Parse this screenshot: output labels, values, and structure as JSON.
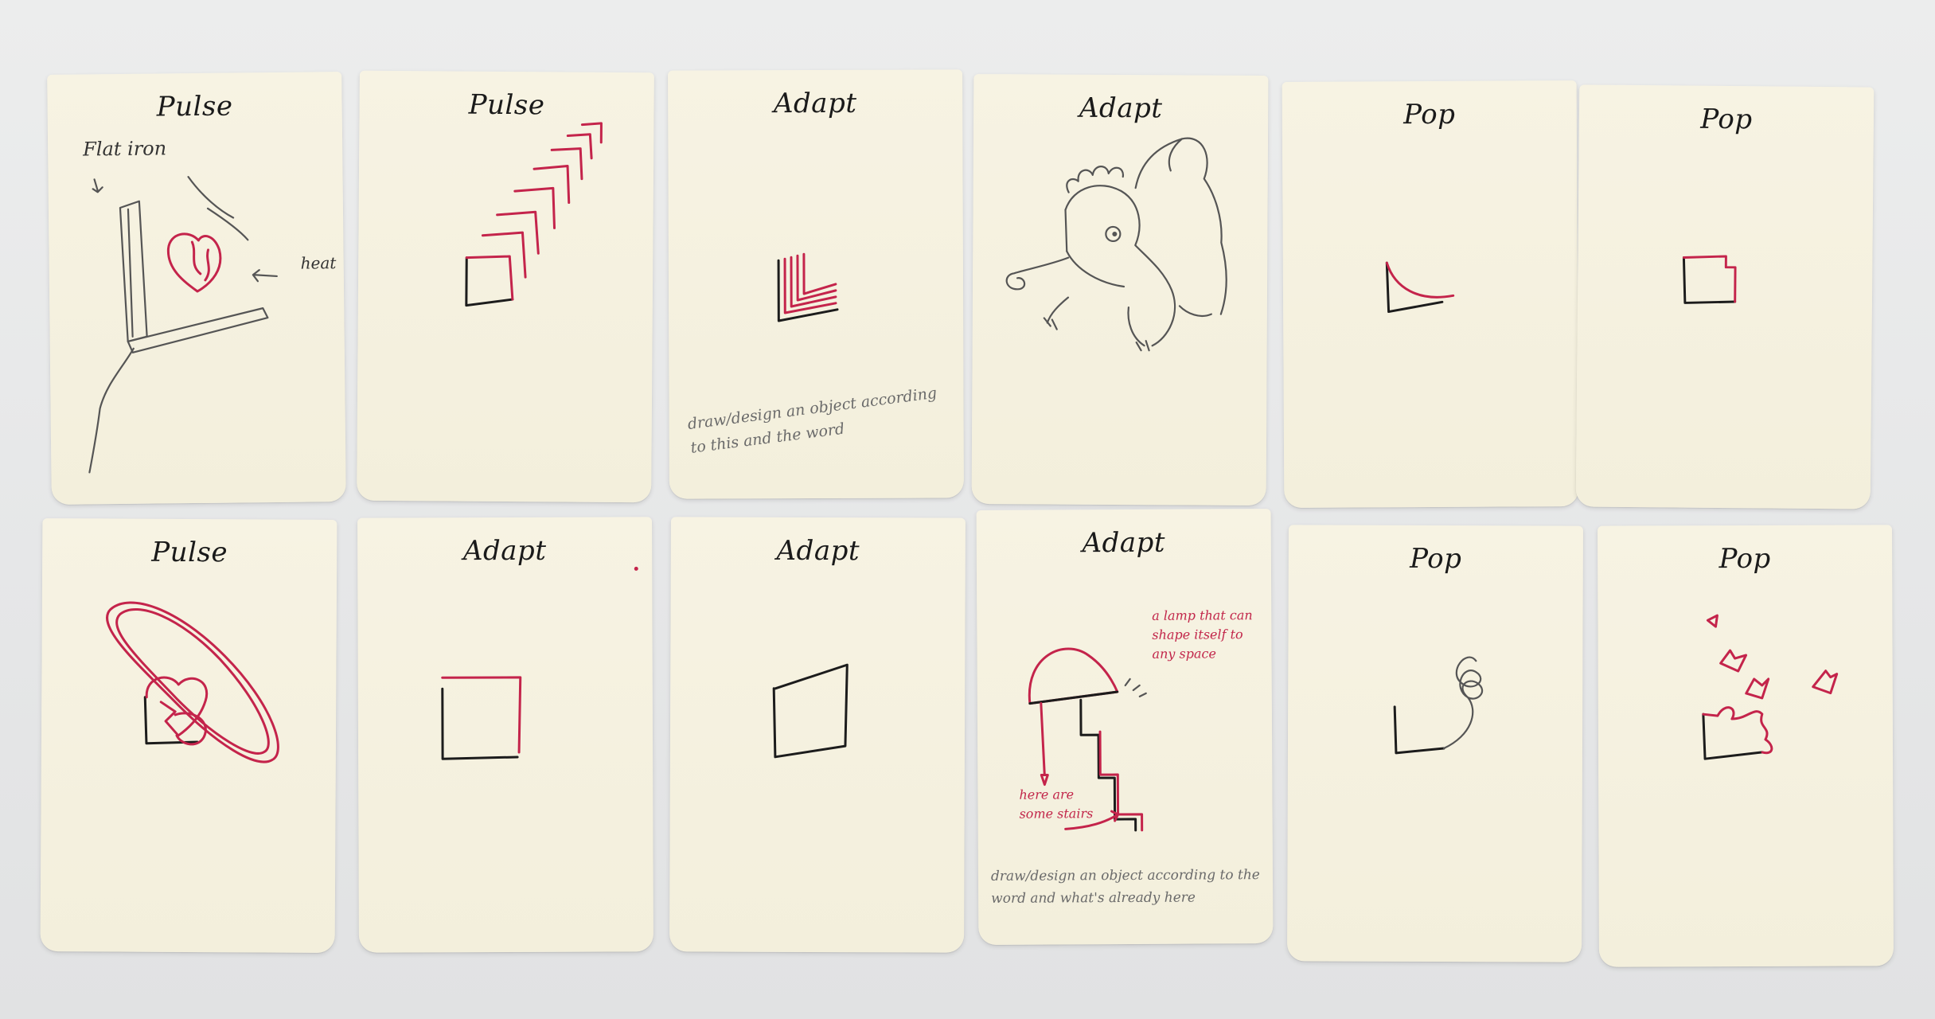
{
  "cards": [
    {
      "title": "Pulse",
      "labels": [
        "Flat iron",
        "heat"
      ]
    },
    {
      "title": "Pulse"
    },
    {
      "title": "Adapt",
      "note": "draw/design an object according to this and the word"
    },
    {
      "title": "Adapt"
    },
    {
      "title": "Pop"
    },
    {
      "title": "Pop"
    },
    {
      "title": "Pulse"
    },
    {
      "title": "Adapt"
    },
    {
      "title": "Adapt"
    },
    {
      "title": "Adapt",
      "annotations": [
        "a lamp that can shape itself to any space",
        "here are some stairs"
      ],
      "note": "draw/design an object according to the word and what's already here"
    },
    {
      "title": "Pop"
    },
    {
      "title": "Pop"
    }
  ],
  "colors": {
    "ink": "#1c1c1c",
    "red_pen": "#c4244b",
    "paper": "#f5f1df",
    "table": "#e6e7e8"
  }
}
